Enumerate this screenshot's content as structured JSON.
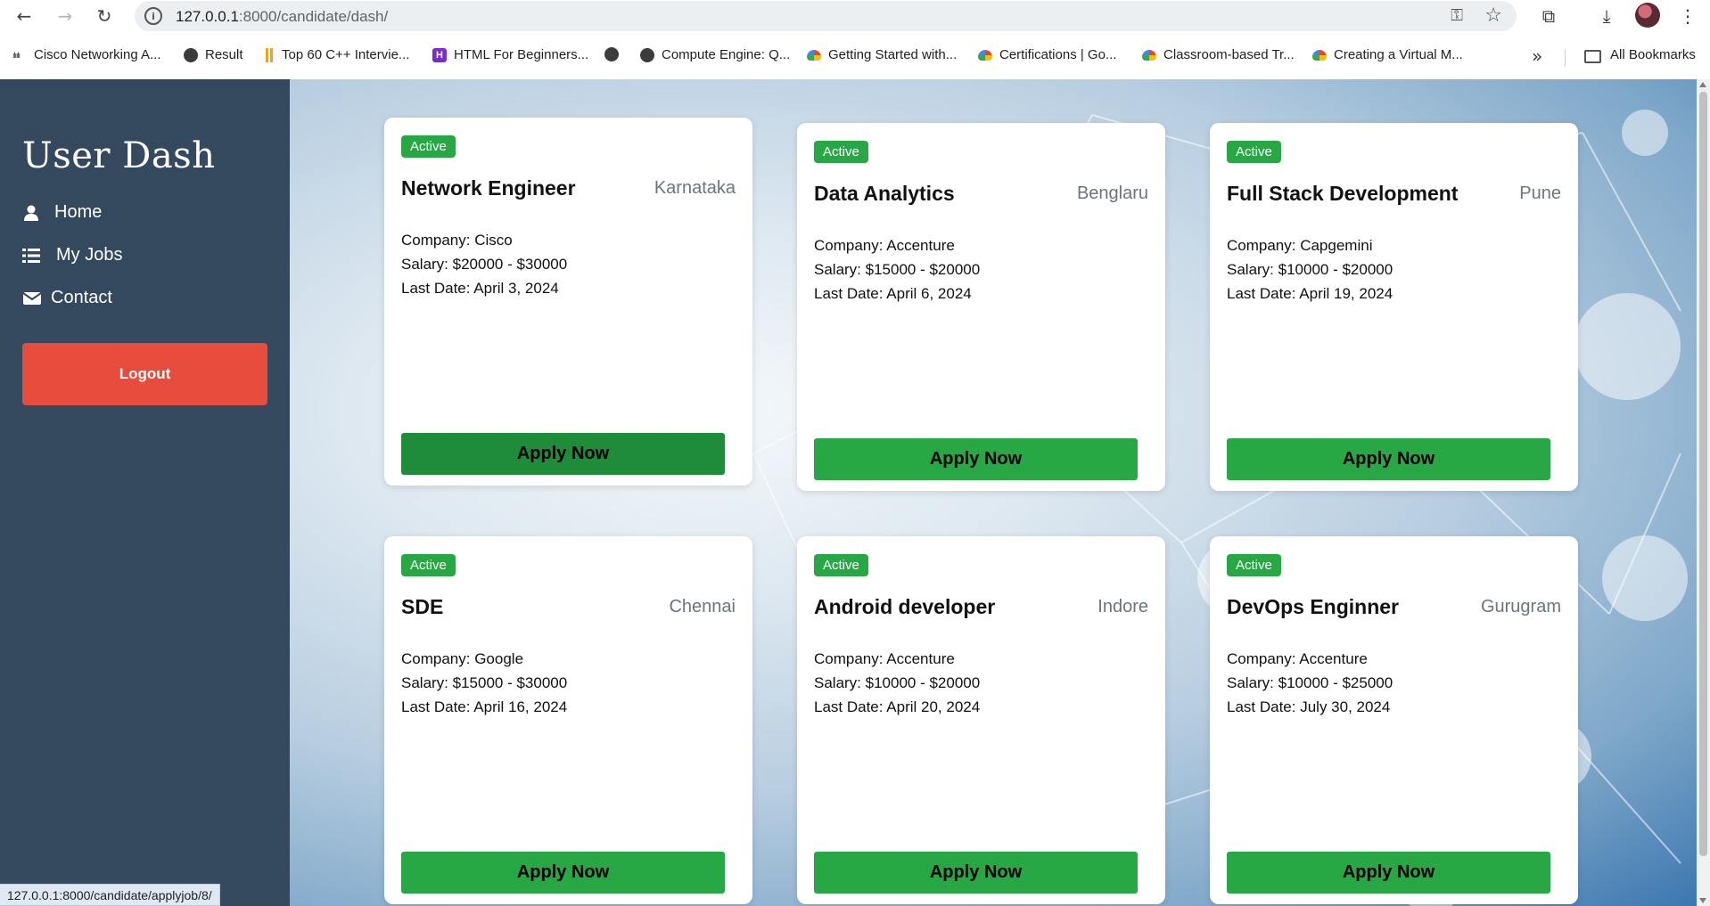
{
  "browser": {
    "url_host": "127.0.0.1",
    "url_path": ":8000/candidate/dash/",
    "status_text": "127.0.0.1:8000/candidate/applyjob/8/",
    "bookmarks": [
      "Cisco Networking A...",
      "Result",
      "Top 60 C++ Intervie...",
      "HTML For Beginners...",
      "",
      "Compute Engine: Q...",
      "Getting Started with...",
      "Certifications  |  Go...",
      "Classroom-based Tr...",
      "Creating a Virtual M..."
    ],
    "all_bookmarks_label": "All Bookmarks"
  },
  "sidebar": {
    "brand": "User Dash",
    "items": [
      {
        "label": "Home",
        "icon": "user-icon"
      },
      {
        "label": "My Jobs",
        "icon": "list-icon"
      },
      {
        "label": "Contact",
        "icon": "envelope-icon"
      }
    ],
    "logout_label": "Logout"
  },
  "jobs": [
    {
      "status": "Active",
      "title": "Network Engineer",
      "location": "Karnataka",
      "company": "Company: Cisco",
      "salary": "Salary: $20000 - $30000",
      "last_date": "Last Date: April 3, 2024",
      "apply_label": "Apply Now"
    },
    {
      "status": "Active",
      "title": "Data Analytics",
      "location": "Benglaru",
      "company": "Company: Accenture",
      "salary": "Salary: $15000 - $20000",
      "last_date": "Last Date: April 6, 2024",
      "apply_label": "Apply Now"
    },
    {
      "status": "Active",
      "title": "Full Stack Development",
      "location": "Pune",
      "company": "Company: Capgemini",
      "salary": "Salary: $10000 - $20000",
      "last_date": "Last Date: April 19, 2024",
      "apply_label": "Apply Now"
    },
    {
      "status": "Active",
      "title": "SDE",
      "location": "Chennai",
      "company": "Company: Google",
      "salary": "Salary: $15000 - $30000",
      "last_date": "Last Date: April 16, 2024",
      "apply_label": "Apply Now"
    },
    {
      "status": "Active",
      "title": "Android developer",
      "location": "Indore",
      "company": "Company: Accenture",
      "salary": "Salary: $10000 - $20000",
      "last_date": "Last Date: April 20, 2024",
      "apply_label": "Apply Now"
    },
    {
      "status": "Active",
      "title": "DevOps Enginner",
      "location": "Gurugram",
      "company": "Company: Accenture",
      "salary": "Salary: $10000 - $25000",
      "last_date": "Last Date: July 30, 2024",
      "apply_label": "Apply Now"
    }
  ],
  "colors": {
    "sidebar": "#34495e",
    "logout": "#e74c3c",
    "active_badge": "#28a745",
    "apply_button": "#28a745",
    "apply_button_hover": "#1e8c38"
  }
}
